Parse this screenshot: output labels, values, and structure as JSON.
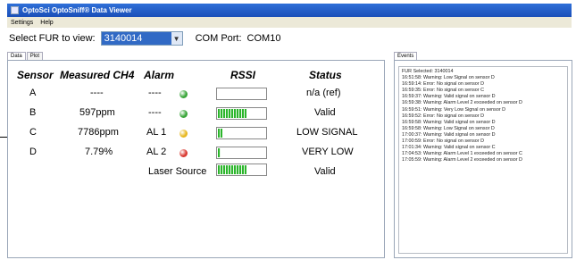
{
  "window": {
    "title": "OptoSci OptoSniff® Data Viewer"
  },
  "menu": [
    "Settings",
    "Help"
  ],
  "selector": {
    "fur_label": "Select FUR to view:",
    "fur_value": "3140014",
    "com_label": "COM Port:",
    "com_value": "COM10"
  },
  "left_tabs": [
    "Data",
    "Plot"
  ],
  "table": {
    "headers": {
      "sensor": "Sensor",
      "ch4": "Measured CH4",
      "alarm": "Alarm",
      "rssi": "RSSI",
      "status": "Status"
    },
    "rows": [
      {
        "sensor": "A",
        "ch4": "----",
        "alarm": "----",
        "led_color": "#3aa63a",
        "rssi_fraction": 0.0,
        "status": "n/a (ref)"
      },
      {
        "sensor": "B",
        "ch4": "597ppm",
        "alarm": "----",
        "led_color": "#3aa63a",
        "rssi_fraction": 0.6,
        "status": "Valid"
      },
      {
        "sensor": "C",
        "ch4": "7786ppm",
        "alarm": "AL 1",
        "led_color": "#e8b820",
        "rssi_fraction": 0.1,
        "status": "LOW SIGNAL"
      },
      {
        "sensor": "D",
        "ch4": "7.79%",
        "alarm": "AL 2",
        "led_color": "#d93a32",
        "rssi_fraction": 0.06,
        "status": "VERY LOW"
      }
    ],
    "laser_row": {
      "label": "Laser Source",
      "rssi_fraction": 0.6,
      "status": "Valid"
    }
  },
  "right_tabs": [
    "Events"
  ],
  "events": [
    "FUR Selected: 3140014",
    "16:51:58: Warning: Low Signal on sensor D",
    "16:59:14: Error: No signal on sensor D",
    "16:59:35: Error: No signal on sensor C",
    "16:59:37: Warning: Valid signal on sensor D",
    "16:59:38: Warning: Alarm Level 2 exceeded on sensor D",
    "16:59:51: Warning: Very Low Signal on sensor D",
    "16:59:52: Error: No signal on sensor D",
    "16:59:58: Warning: Valid signal on sensor D",
    "16:59:58: Warning: Low Signal on sensor D",
    "17:00:37: Warning: Valid signal on sensor D",
    "17:00:59: Error: No signal on sensor D",
    "17:01:34: Warning: Valid signal on sensor C",
    "17:04:53: Warning: Alarm Level 1 exceeded on sensor C",
    "17:05:59: Warning: Alarm Level 2 exceeded on sensor D"
  ]
}
